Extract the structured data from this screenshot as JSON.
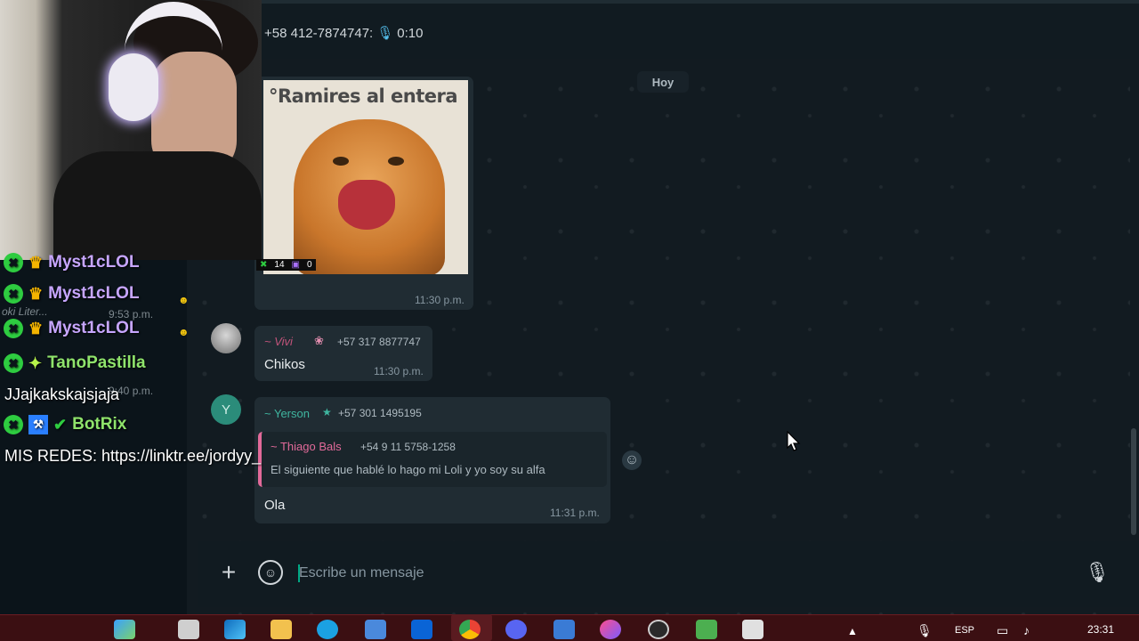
{
  "header": {
    "voice_sender": "+58 412-7874747:",
    "voice_duration": "0:10"
  },
  "chat": {
    "day_divider": "Hoy",
    "image_message": {
      "caption": "°Ramires al entera",
      "time": "11:30 p.m."
    },
    "vivi_message": {
      "sender": "~ Vivi",
      "phone": "+57 317 8877747",
      "text": "Chikos",
      "time": "11:30 p.m."
    },
    "yerson_message": {
      "avatar_letter": "Y",
      "sender": "~ Yerson",
      "phone": "+57 301 1495195",
      "quote_sender": "~ Thiago Bals",
      "quote_phone": "+54 9 11 5758-1258",
      "quote_text": "El siguiente que hablé lo hago mi Loli y yo soy su alfa",
      "text": "Ola",
      "time": "11:31 p.m."
    }
  },
  "composer": {
    "placeholder": "Escribe un mensaje"
  },
  "stream_overlay": {
    "viewer_count_a": "14",
    "viewer_count_b": "0",
    "rows": [
      {
        "user": "Myst1cLOL",
        "time": ""
      },
      {
        "user": "Myst1cLOL",
        "time": "9:53 p.m."
      },
      {
        "user": "Myst1cLOL",
        "time": ""
      },
      {
        "user": "TanoPastilla",
        "time": ""
      },
      {
        "user": "BotRix",
        "time": ""
      }
    ],
    "faint_text": "oki Liter...",
    "faint_time2": "9:40 p.m.",
    "message_1": "JJajkakskajsjaja",
    "message_2": "MIS REDES: https://linktr.ee/jordyy_"
  },
  "taskbar": {
    "language": "ESP",
    "clock": "23:31"
  },
  "colors": {
    "chat_bg": "#121b21",
    "bubble": "#202c33",
    "accent_green": "#00a884",
    "quote_pink": "#e26a9a",
    "taskbar": "#3b0f12"
  }
}
